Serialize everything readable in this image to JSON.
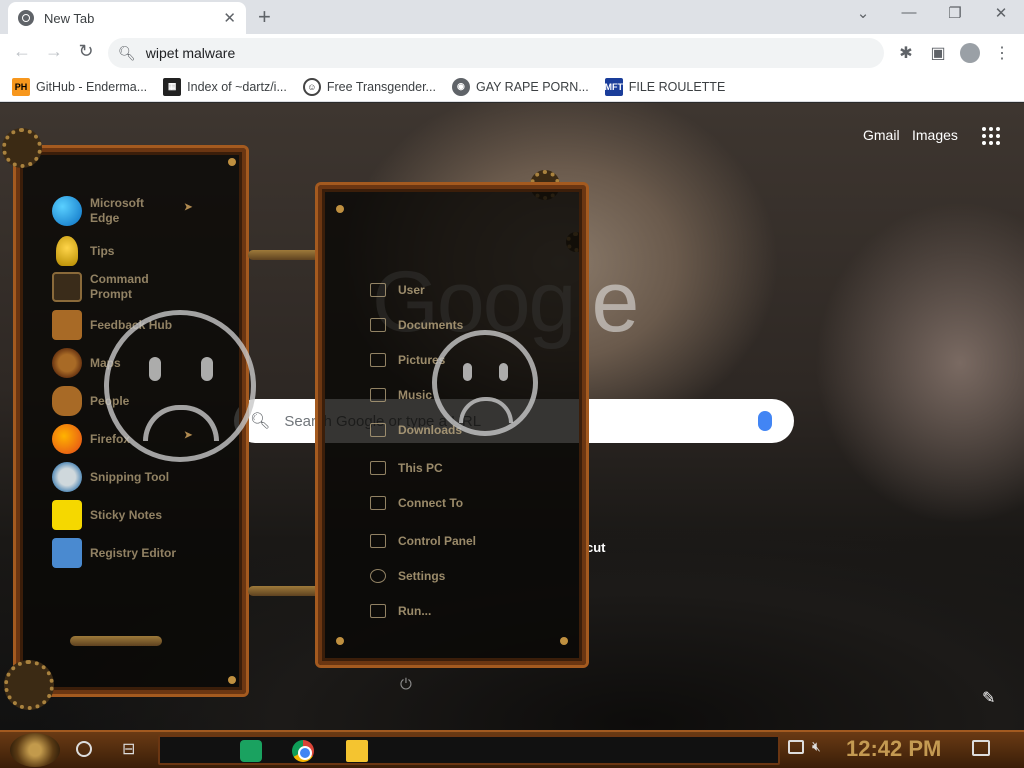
{
  "browser": {
    "tab_title": "New Tab",
    "tab_close": "✕",
    "new_tab": "+",
    "window_controls": [
      "⌄",
      "—",
      "❐",
      "✕"
    ],
    "address": "wipet malware",
    "bookmarks": [
      {
        "icon": "PH",
        "label": "GitHub - Enderma..."
      },
      {
        "icon": "▦",
        "label": "Index of ~dartz/i..."
      },
      {
        "icon": "☺",
        "label": "Free Transgender..."
      },
      {
        "icon": "◉",
        "label": "GAY RAPE PORN..."
      },
      {
        "icon": "MFT",
        "label": "FILE ROULETTE"
      }
    ]
  },
  "newtab": {
    "gmail": "Gmail",
    "images": "Images",
    "logo": "Google",
    "search_placeholder": "Search Google or type a URL",
    "shortcut_fragment": "cut"
  },
  "start_menu": {
    "left_items": [
      {
        "label": "Microsoft Edge",
        "icon": "edge-icon",
        "has_arrow": true
      },
      {
        "label": "Tips",
        "icon": "tips-icon"
      },
      {
        "label": "Command Prompt",
        "icon": "command-prompt-icon"
      },
      {
        "label": "Feedback Hub",
        "icon": "feedback-hub-icon"
      },
      {
        "label": "Maps",
        "icon": "maps-icon"
      },
      {
        "label": "People",
        "icon": "people-icon"
      },
      {
        "label": "Firefox",
        "icon": "firefox-icon",
        "has_arrow": true
      },
      {
        "label": "Snipping Tool",
        "icon": "snipping-tool-icon"
      },
      {
        "label": "Sticky Notes",
        "icon": "sticky-notes-icon"
      },
      {
        "label": "Registry Editor",
        "icon": "registry-editor-icon"
      }
    ],
    "right_items": [
      {
        "label": "User",
        "icon": "user-icon"
      },
      {
        "label": "Documents",
        "icon": "documents-icon"
      },
      {
        "label": "Pictures",
        "icon": "pictures-icon"
      },
      {
        "label": "Music",
        "icon": "music-icon"
      },
      {
        "label": "Downloads",
        "icon": "downloads-icon"
      },
      {
        "label": "This PC",
        "icon": "this-pc-icon"
      },
      {
        "label": "Connect To",
        "icon": "connect-to-icon"
      },
      {
        "label": "Control Panel",
        "icon": "control-panel-icon"
      },
      {
        "label": "Settings",
        "icon": "settings-icon"
      },
      {
        "label": "Run...",
        "icon": "run-icon"
      }
    ]
  },
  "taskbar": {
    "clock": "12:42 PM",
    "pinned": [
      "sheets-icon",
      "chrome-icon",
      "file-explorer-icon"
    ]
  },
  "colors": {
    "accent_copper": "#a45a1f",
    "clock": "#c49a52",
    "menu_text": "#bea682"
  }
}
